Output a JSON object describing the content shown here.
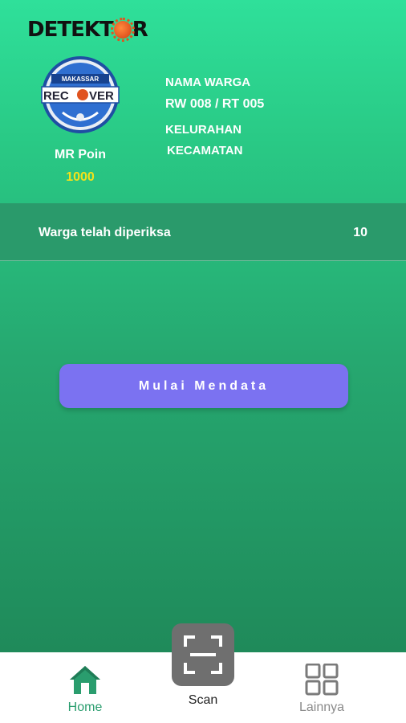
{
  "header": {
    "app_logo": {
      "text_before": "DETEKT",
      "text_after": "R",
      "icon": "virus-icon"
    },
    "badge": {
      "icon": "makassar-recover-badge",
      "top_text": "MAKASSAR",
      "main_text_before": "REC",
      "main_text_after": "VER"
    },
    "points_label": "MR Poin",
    "points_value": "1000",
    "points_color": "#f4e21a"
  },
  "citizen": {
    "name": "NAMA WARGA",
    "rw_rt": "RW 008 / RT 005",
    "kelurahan": "KELURAHAN",
    "kecamatan": "KECAMATAN"
  },
  "stats": {
    "label": "Warga telah diperiksa",
    "value": "10"
  },
  "actions": {
    "start_label": "Mulai Mendata",
    "accent": "#7b72f1"
  },
  "bottom_nav": {
    "items": [
      {
        "label": "Home",
        "icon": "home-icon",
        "active": true
      },
      {
        "label": "Scan",
        "icon": "scan-icon"
      },
      {
        "label": "Lainnya",
        "icon": "grid-icon"
      }
    ],
    "active_color": "#2a9d6e"
  }
}
